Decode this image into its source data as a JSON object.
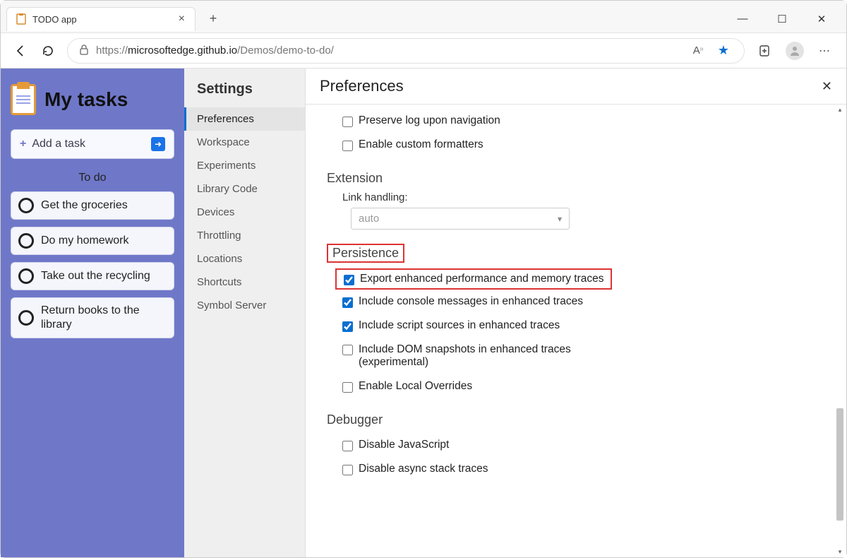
{
  "browser": {
    "tab_title": "TODO app",
    "url_host": "microsoftedge.github.io",
    "url_prefix": "https://",
    "url_path": "/Demos/demo-to-do/"
  },
  "app": {
    "title": "My tasks",
    "add_task_label": "Add a task",
    "todo_heading": "To do",
    "tasks": [
      "Get the groceries",
      "Do my homework",
      "Take out the recycling",
      "Return books to the library"
    ]
  },
  "settings": {
    "heading": "Settings",
    "items": [
      "Preferences",
      "Workspace",
      "Experiments",
      "Library Code",
      "Devices",
      "Throttling",
      "Locations",
      "Shortcuts",
      "Symbol Server"
    ],
    "active_index": 0
  },
  "prefs": {
    "title": "Preferences",
    "top_checks": [
      {
        "label": "Preserve log upon navigation",
        "checked": false
      },
      {
        "label": "Enable custom formatters",
        "checked": false
      }
    ],
    "extension": {
      "heading": "Extension",
      "link_label": "Link handling:",
      "link_value": "auto"
    },
    "persistence": {
      "heading": "Persistence",
      "checks": [
        {
          "label": "Export enhanced performance and memory traces",
          "checked": true,
          "highlight": true
        },
        {
          "label": "Include console messages in enhanced traces",
          "checked": true
        },
        {
          "label": "Include script sources in enhanced traces",
          "checked": true
        },
        {
          "label": "Include DOM snapshots in enhanced traces (experimental)",
          "checked": false
        },
        {
          "label": "Enable Local Overrides",
          "checked": false
        }
      ]
    },
    "debugger": {
      "heading": "Debugger",
      "checks": [
        {
          "label": "Disable JavaScript",
          "checked": false
        },
        {
          "label": "Disable async stack traces",
          "checked": false
        }
      ]
    }
  }
}
